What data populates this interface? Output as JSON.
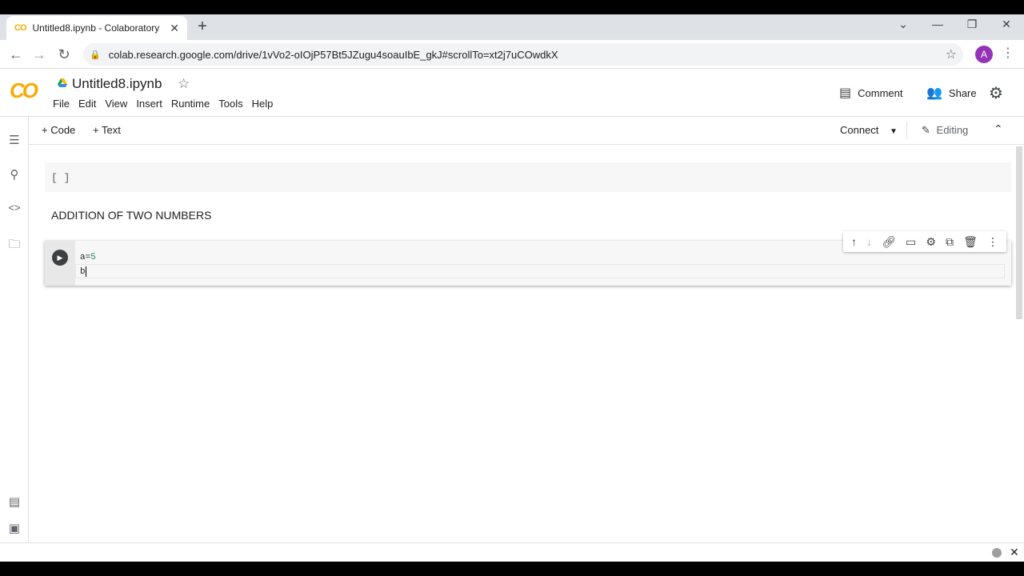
{
  "browser": {
    "tab_favicon": "CO",
    "tab_title": "Untitled8.ipynb - Colaboratory",
    "tab_close": "✕",
    "new_tab": "+",
    "url": "colab.research.google.com/drive/1vVo2-oIOjP57Bt5JZugu4soauIbE_gkJ#scrollTo=xt2j7uCOwdkX",
    "avatar_letter": "A"
  },
  "colab": {
    "logo": "CO",
    "notebook_name": "Untitled8.ipynb",
    "menu": [
      "File",
      "Edit",
      "View",
      "Insert",
      "Runtime",
      "Tools",
      "Help"
    ],
    "comment_label": "Comment",
    "share_label": "Share",
    "add_code_label": "+ Code",
    "add_text_label": "+ Text",
    "connect_label": "Connect",
    "editing_label": "Editing"
  },
  "cells": {
    "empty_cell_prompt": "[ ]",
    "text_cell": "ADDITION OF TWO NUMBERS",
    "code_line1_var": "a=",
    "code_line1_num": "5",
    "code_line2": "b"
  },
  "colors": {
    "colab_orange": "#f9ab00",
    "avatar_purple": "#9334b8"
  }
}
